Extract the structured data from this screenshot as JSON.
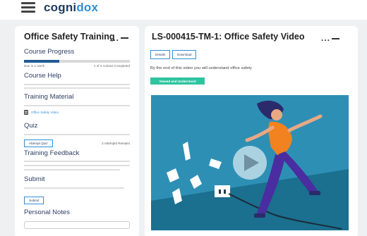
{
  "header": {
    "brand_part1": "cogni",
    "brand_part2": "dox"
  },
  "training": {
    "title": "Office Safety Training",
    "menu_dots": "...",
    "progress": {
      "title": "Course Progress",
      "fraction": 0.33,
      "due": "Due in 1 week",
      "actions": "1 of 3 Actions Completed"
    },
    "help_title": "Course Help",
    "material": {
      "title": "Training Material",
      "items": [
        {
          "label": "Office Safety Video",
          "icon": "document-icon"
        }
      ]
    },
    "quiz": {
      "title": "Quiz",
      "button": "Attempt Quiz",
      "remaining": "2 Attempts Remaini"
    },
    "feedback_title": "Training Feedback",
    "submit": {
      "title": "Submit",
      "button": "Submit"
    },
    "notes_title": "Personal Notes"
  },
  "video_panel": {
    "title": "LS-000415-TM-1: Office Safety Video",
    "menu_dots": "...",
    "tabs": [
      "Details",
      "Download"
    ],
    "description": "By the end of this video you will understand office safety",
    "ack_button": "Viewed and Understood",
    "video_thumbnail": "woman-tripping-over-cable-illustration",
    "play_icon": "play-icon"
  },
  "colors": {
    "brand_dark": "#1e3a5f",
    "brand_light": "#2f8fd6",
    "progress_fill": "#1f5a92",
    "ack_button": "#2ec4a0",
    "video_bg": "#2e8fb5"
  }
}
